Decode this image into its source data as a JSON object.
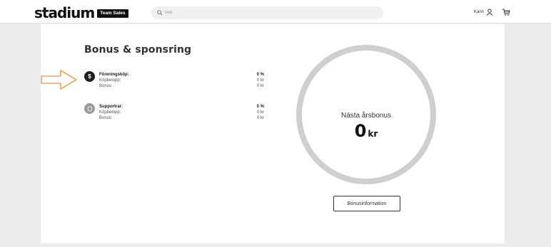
{
  "header": {
    "logo_text": "stadium",
    "logo_badge": "Team Sales",
    "search_placeholder": "Sök",
    "user_name": "Karin"
  },
  "page": {
    "title": "Bonus & sponsring"
  },
  "rows": [
    {
      "icon": "$",
      "lines": [
        {
          "label": "Föreningsköp:",
          "value": "0 %"
        },
        {
          "label": "Köpbelopp:",
          "value": "0 kr"
        },
        {
          "label": "Bonus:",
          "value": "0 kr"
        }
      ]
    },
    {
      "icon": "shield",
      "lines": [
        {
          "label": "Supportrar:",
          "value": "0 %"
        },
        {
          "label": "Köpbelopp:",
          "value": "0 kr"
        },
        {
          "label": "Bonus:",
          "value": "0 kr"
        }
      ]
    }
  ],
  "bonus_ring": {
    "title": "Nästa årsbonus",
    "value": "0",
    "unit": "kr",
    "progress": 0
  },
  "info_button": "Bonusinformation",
  "colors": {
    "arrow": "#f2a65a",
    "ring": "#cfcfcf",
    "dark_icon": "#1f1f1f",
    "grey_icon": "#9a9a9a"
  }
}
